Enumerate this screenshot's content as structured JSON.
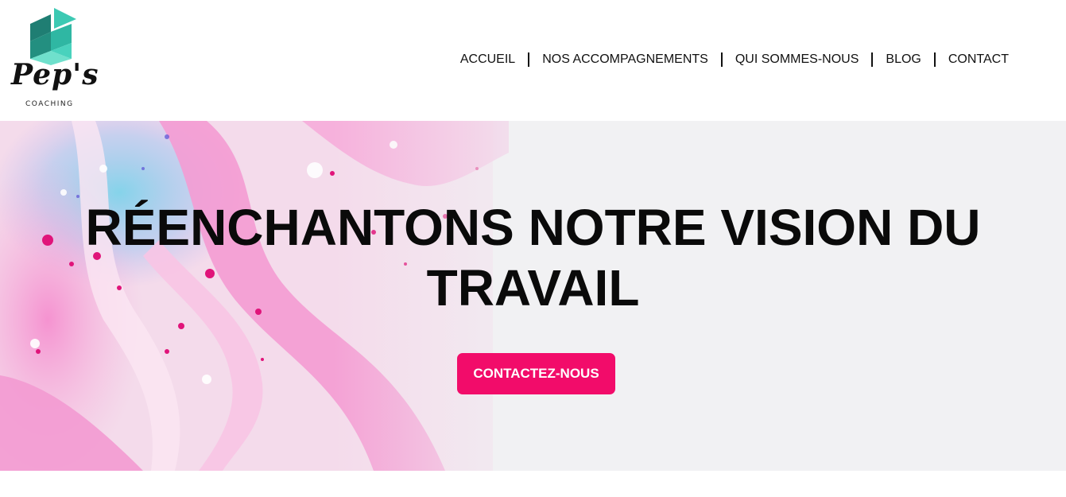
{
  "brand": {
    "name": "Pep's",
    "tagline": "COACHING",
    "colors": {
      "teal_dark": "#1f7e73",
      "teal": "#2fb7a3",
      "teal_light": "#6fe0cc"
    }
  },
  "nav": {
    "items": [
      {
        "label": "ACCUEIL"
      },
      {
        "label": "NOS ACCOMPAGNEMENTS"
      },
      {
        "label": "QUI SOMMES-NOUS"
      },
      {
        "label": "BLOG"
      },
      {
        "label": "CONTACT"
      }
    ]
  },
  "hero": {
    "title_line1": "RÉENCHANTONS NOTRE VISION DU",
    "title_line2": "TRAVAIL",
    "cta_label": "CONTACTEZ-NOUS",
    "accent_color": "#f20c6a"
  }
}
